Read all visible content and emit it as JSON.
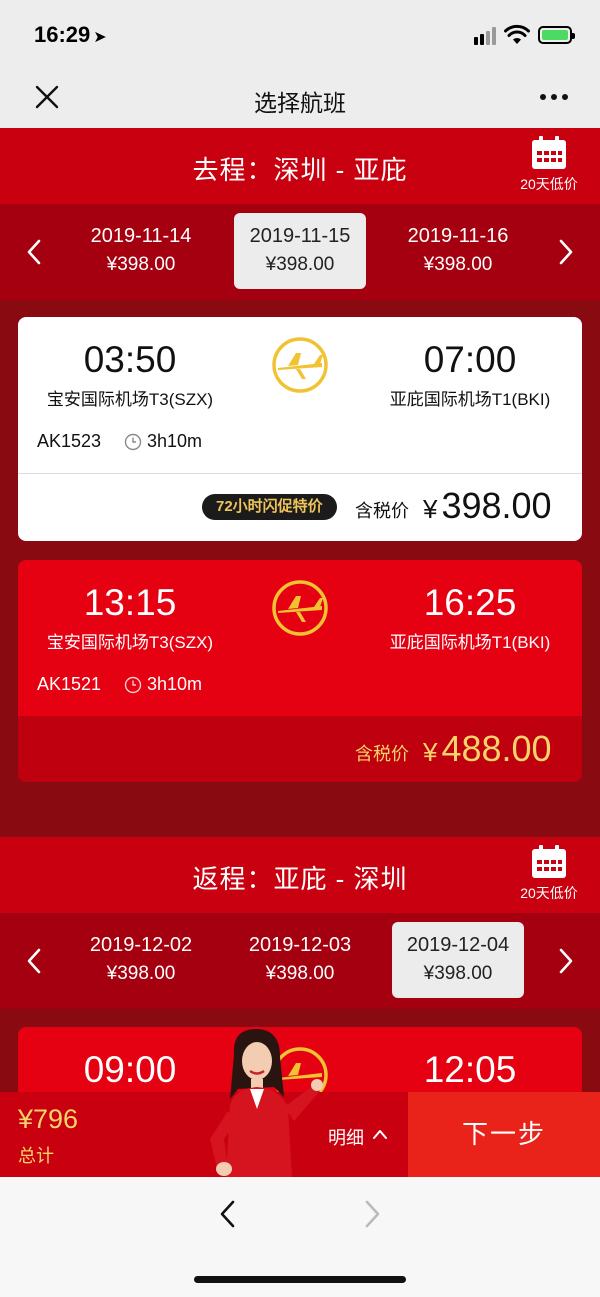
{
  "status_bar": {
    "time": "16:29",
    "location_glyph": "➤"
  },
  "nav": {
    "title": "选择航班"
  },
  "outbound": {
    "route_label": "去程：深圳 - 亚庇",
    "calendar_label": "20天低价",
    "dates": [
      {
        "date": "2019-11-14",
        "price": "¥398.00",
        "selected": false
      },
      {
        "date": "2019-11-15",
        "price": "¥398.00",
        "selected": true
      },
      {
        "date": "2019-11-16",
        "price": "¥398.00",
        "selected": false
      }
    ],
    "flights": [
      {
        "dep_time": "03:50",
        "dep_airport": "宝安国际机场T3(SZX)",
        "arr_time": "07:00",
        "arr_airport": "亚庇国际机场T1(BKI)",
        "flight_no": "AK1523",
        "duration": "3h10m",
        "promo": "72小时闪促特价",
        "tax_label": "含税价",
        "currency": "¥",
        "price": "398.00"
      },
      {
        "dep_time": "13:15",
        "dep_airport": "宝安国际机场T3(SZX)",
        "arr_time": "16:25",
        "arr_airport": "亚庇国际机场T1(BKI)",
        "flight_no": "AK1521",
        "duration": "3h10m",
        "tax_label": "含税价",
        "currency": "¥",
        "price": "488.00"
      }
    ]
  },
  "return": {
    "route_label": "返程：亚庇 - 深圳",
    "calendar_label": "20天低价",
    "dates": [
      {
        "date": "2019-12-02",
        "price": "¥398.00",
        "selected": false
      },
      {
        "date": "2019-12-03",
        "price": "¥398.00",
        "selected": false
      },
      {
        "date": "2019-12-04",
        "price": "¥398.00",
        "selected": true
      }
    ],
    "flights": [
      {
        "dep_time": "09:00",
        "arr_time": "12:05"
      }
    ]
  },
  "bottom": {
    "total": "¥796",
    "total_label": "总计",
    "detail_label": "明细",
    "next_label": "下一步"
  },
  "colors": {
    "brand_red": "#c8000f",
    "card_red": "#e50012",
    "gold": "#f8d36a",
    "next_red": "#e9231a",
    "logo_gold": "#f1c232"
  },
  "icons": [
    "location-arrow-icon",
    "signal-icon",
    "wifi-icon",
    "battery-icon",
    "close-icon",
    "more-icon",
    "calendar-icon",
    "chevron-left-icon",
    "chevron-right-icon",
    "airline-logo-icon",
    "clock-icon",
    "chevron-up-icon",
    "browser-back-icon",
    "browser-forward-icon"
  ]
}
